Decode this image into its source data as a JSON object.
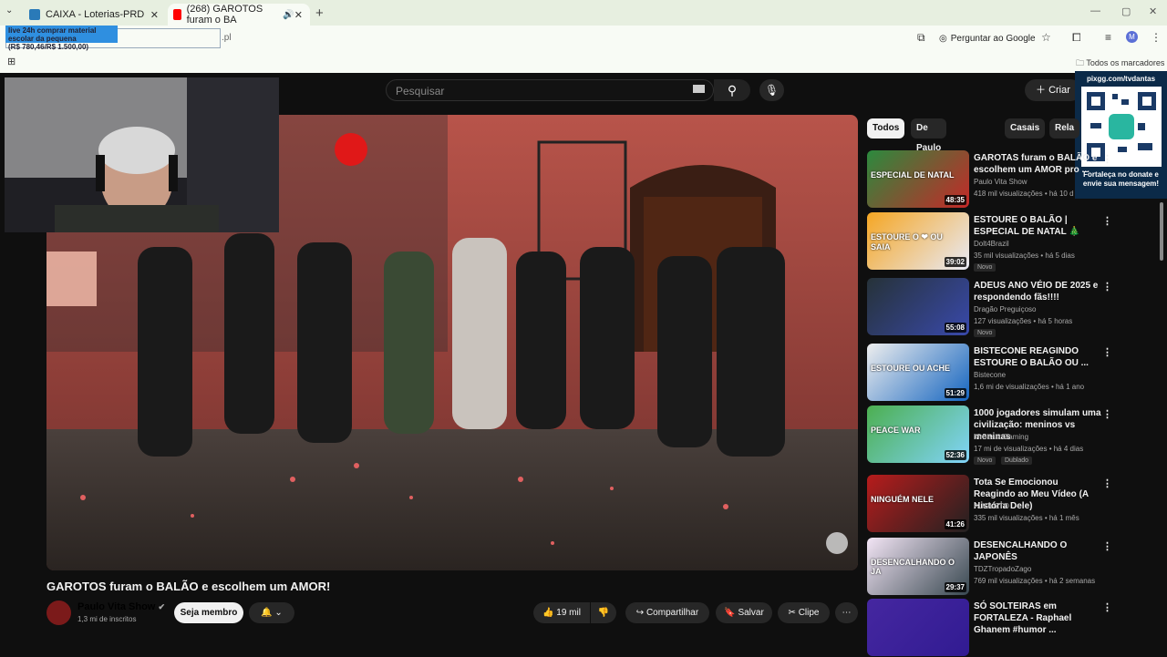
{
  "browser": {
    "tabs": [
      {
        "title": "CAIXA - Loterias-PRD"
      },
      {
        "title": "(268) GAROTOS furam o BA"
      }
    ],
    "omnibox_overlay_line1": "live 24h comprar material escolar da pequena",
    "omnibox_overlay_line2": "(R$ 780,46/R$ 1.500,00)",
    "url_tail": ".pl",
    "ask_google": "Perguntar ao Google",
    "profile_initial": "M",
    "all_bookmarks": "Todos os marcadores"
  },
  "youtube": {
    "search_placeholder": "Pesquisar",
    "create_label": "Criar",
    "video_title": "GAROTOS furam o BALÃO e escolhem um AMOR!",
    "channel_name": "Paulo Vita Show",
    "channel_subs": "1,3 mi de inscritos",
    "member_label": "Seja membro",
    "likes": "19 mil",
    "share_label": "Compartilhar",
    "save_label": "Salvar",
    "clip_label": "Clipe",
    "chips": [
      "Todos",
      "De Paulo Vita Show",
      "Casais",
      "Rela"
    ],
    "qr_site": "pixgg.com/tvdantas",
    "qr_text": "Fortaleça no donate e envie sua mensagem!",
    "recommended": [
      {
        "title": "GAROTAS furam o BALÃO e escolhem um AMOR pro ...",
        "channel": "Paulo Vita Show",
        "views": "418 mil visualizações",
        "age": "há 10 d",
        "duration": "48:35",
        "badge": "",
        "thumb_text": "ESPECIAL DE NATAL"
      },
      {
        "title": "ESTOURE O BALÃO | ESPECIAL DE NATAL 🎄",
        "channel": "Dolt4Brazil",
        "views": "35 mil visualizações",
        "age": "há 5 dias",
        "duration": "39:02",
        "badge": "Novo",
        "thumb_text": "ESTOURE O ❤ OU SAIA"
      },
      {
        "title": "ADEUS ANO VÉIO DE 2025 e respondendo fãs!!!!",
        "channel": "Dragão Preguiçoso",
        "views": "127 visualizações",
        "age": "há 5 horas",
        "duration": "55:08",
        "badge": "Novo",
        "thumb_text": ""
      },
      {
        "title": "BISTECONE REAGINDO ESTOURE O BALÃO OU ...",
        "channel": "Bistecone",
        "views": "1,6 mi de visualizações",
        "age": "há 1 ano",
        "duration": "51:29",
        "badge": "",
        "thumb_text": "ESTOURE OU ACHE"
      },
      {
        "title": "1000 jogadores simulam uma civilização: meninos vs meninas",
        "channel": "MrBeast Gaming",
        "views": "17 mi de visualizações",
        "age": "há 4 dias",
        "duration": "52:36",
        "badge": "Novo",
        "badge2": "Dublado",
        "thumb_text": "PEACE WAR"
      },
      {
        "title": "Tota Se Emocionou Reagindo ao Meu Vídeo (A História Dele)",
        "channel": "AUGUZTO",
        "views": "335 mil visualizações",
        "age": "há 1 mês",
        "duration": "41:26",
        "badge": "",
        "thumb_text": "NINGUÉM NELE"
      },
      {
        "title": "DESENCALHANDO O JAPONÊS",
        "channel": "TDZTropadoZago",
        "views": "769 mil visualizações",
        "age": "há 2 semanas",
        "duration": "29:37",
        "badge": "",
        "thumb_text": "DESENCALHANDO O JA"
      },
      {
        "title": "SÓ SOLTEIRAS em FORTALEZA - Raphael Ghanem #humor ...",
        "channel": "",
        "views": "",
        "age": "",
        "duration": "",
        "badge": "",
        "thumb_text": ""
      }
    ]
  },
  "colors": {
    "bg": "#0f0f0f",
    "chrome": "#e7efe0",
    "accent_red": "#ff0000"
  }
}
